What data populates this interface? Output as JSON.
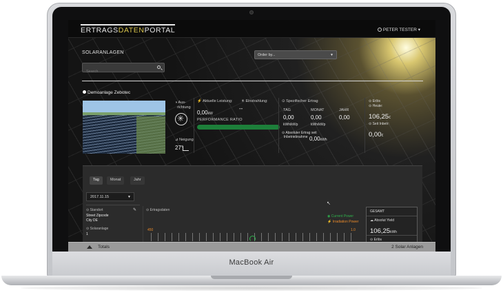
{
  "device": {
    "brand": "MacBook Air"
  },
  "header": {
    "logo_part1": "ERTRAGS",
    "logo_accent": "DATEN",
    "logo_part2": "PORTAL",
    "user": "PETER TESTER"
  },
  "page": {
    "title": "SOLARANLAGEN"
  },
  "search": {
    "placeholder": "Search"
  },
  "order": {
    "placeholder": "Order by..."
  },
  "plant": {
    "name": "Demoanlage Zebotec",
    "ausrichtung_label_1": "Aus-",
    "ausrichtung_label_2": "richtung",
    "neigung_label": "Neigung",
    "neigung_value": "27°",
    "aktuelle_leistung_label": "Aktuelle Leistung:",
    "aktuelle_leistung_value": "0,00",
    "aktuelle_leistung_unit": "kW",
    "einstrahlung_label": "Einstrahlung:",
    "einstrahlung_value": "--",
    "performance_ratio_label": "PERFORMANCE RATIO",
    "performance_ratio_value": 1.0,
    "spez_ertrag_label": "Spezifischer Ertrag",
    "spez_cols": [
      {
        "label": "TAG",
        "value": "0,00",
        "unit": "kWh/kWp"
      },
      {
        "label": "MONAT",
        "value": "0,00",
        "unit": "kWh/kWp"
      },
      {
        "label": "JAHR",
        "value": "0,00",
        "unit": ""
      }
    ],
    "abs_ertrag_label_1": "Absoluter Ertrag seit",
    "abs_ertrag_label_2": "Inbetriebnahme",
    "abs_ertrag_value": "0,00",
    "abs_ertrag_unit": "kWh",
    "erlos_label": "Erlös",
    "heute_label": "Heute:",
    "heute_value": "106,25",
    "heute_unit": "€",
    "seit_label": "Seit Inbetr:",
    "seit_value": "0,00",
    "seit_unit": "€"
  },
  "detail": {
    "tabs": [
      "Tag",
      "Monat",
      "Jahr"
    ],
    "date": "2017.11.15",
    "standort_label": "Standort",
    "address_1": "Street Zipcode",
    "address_2": "City DE",
    "solaranlage_label": "Solaranlage",
    "solaranlage_value": "1",
    "ertragsdaten_label": "Ertragsdaten",
    "y_tick_left": "450",
    "y_tick_right": "1.0",
    "legend_current": "Current Power",
    "legend_irradiation": "Irradiation Power",
    "gesamt_label": "GESAMT",
    "absolut_yield_label": "Absolut Yield",
    "absolut_yield_value": "106,25",
    "absolut_yield_unit": "kWh",
    "erlos_label": "Erlös"
  },
  "footer": {
    "totals_label": "Totals",
    "count_label": "2 Solar Anlagen"
  },
  "colors": {
    "accent": "#d6c24a",
    "green": "#2fb14d",
    "orange": "#e8892b"
  }
}
